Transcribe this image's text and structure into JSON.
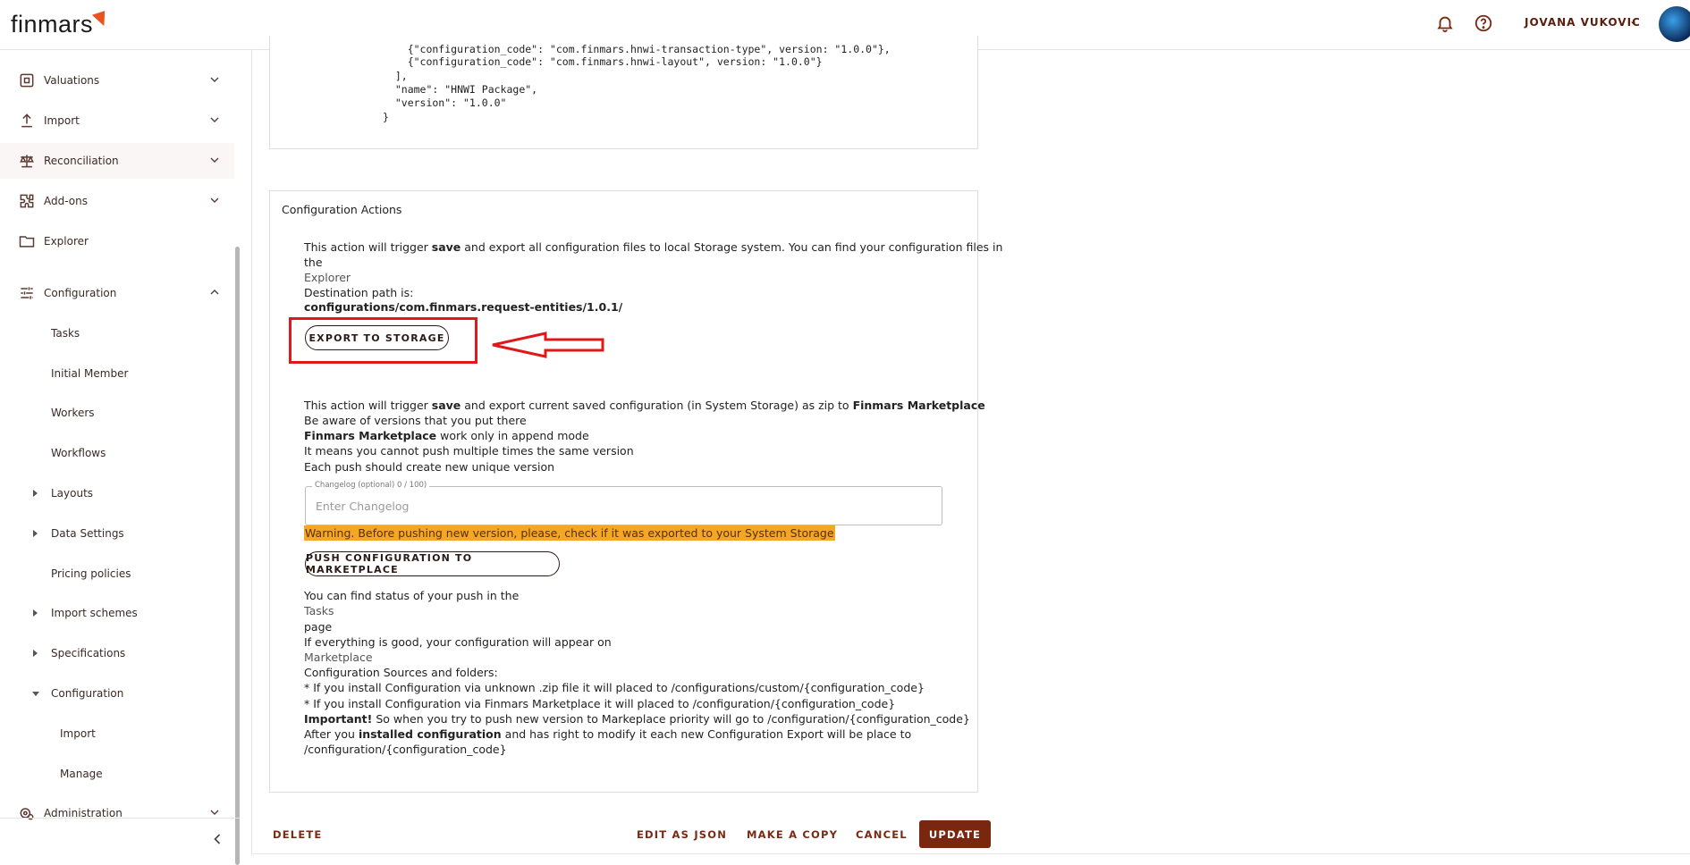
{
  "header": {
    "logo_text": "finmars",
    "user_name": "JOVANA VUKOVIC"
  },
  "sidebar": {
    "top_items": [
      {
        "label": "Valuations",
        "icon": "valuations-icon"
      },
      {
        "label": "Import",
        "icon": "import-icon"
      },
      {
        "label": "Reconciliation",
        "icon": "scale-icon"
      },
      {
        "label": "Add-ons",
        "icon": "puzzle-icon"
      },
      {
        "label": "Explorer",
        "icon": "folder-icon"
      },
      {
        "label": "Configuration",
        "icon": "sliders-icon"
      }
    ],
    "config_children": [
      {
        "label": "Tasks"
      },
      {
        "label": "Initial Member"
      },
      {
        "label": "Workers"
      },
      {
        "label": "Workflows"
      },
      {
        "label": "Layouts"
      },
      {
        "label": "Data Settings"
      },
      {
        "label": "Pricing policies"
      },
      {
        "label": "Import schemes"
      },
      {
        "label": "Specifications"
      },
      {
        "label": "Configuration"
      }
    ],
    "config_sub_children": [
      {
        "label": "Import"
      },
      {
        "label": "Manage"
      }
    ],
    "administration_label": "Administration"
  },
  "code_block": {
    "lines": [
      "    {\"configuration_code\": \"com.finmars.hnwi-transaction-type\", version: \"1.0.0\"},",
      "    {\"configuration_code\": \"com.finmars.hnwi-layout\", version: \"1.0.0\"}",
      "  ],",
      "  \"name\": \"HNWI Package\",",
      "  \"version\": \"1.0.0\"",
      "}"
    ]
  },
  "actions": {
    "title": "Configuration Actions",
    "export": {
      "line1_pre": "This action will trigger ",
      "line1_bold": "save",
      "line1_post": " and export all configuration files to local Storage system. You can find your configuration files in",
      "line1_cont": "the",
      "explorer_link": "Explorer",
      "dest_label": "Destination path is:",
      "dest_path": "configurations/com.finmars.request-entities/1.0.1/",
      "button_label": "EXPORT TO STORAGE"
    },
    "push": {
      "line1_pre": "This action will trigger ",
      "line1_bold": "save",
      "line1_mid": " and export current saved configuration (in System Storage) as zip to ",
      "line1_bold2": "Finmars Marketplace",
      "line2": "Be aware of versions that you put there",
      "line3_bold": "Finmars Marketplace",
      "line3_post": " work only in append mode",
      "line4": "It means you cannot push multiple times the same version",
      "line5": "Each push should create new unique version",
      "changelog_label": "Changelog (optional) 0 / 100)",
      "changelog_placeholder": "Enter Changelog",
      "warning": "Warning. Before pushing new version, please, check if it was exported to your System Storage",
      "button_label": "PUSH CONFIGURATION TO MARKETPLACE"
    },
    "info": {
      "status_line": "You can find status of your push in the",
      "tasks_link": "Tasks",
      "page_word": "page",
      "good_line": "If everything is good, your configuration will appear on",
      "marketplace_link": "Marketplace",
      "sources_line": "Configuration Sources and folders:",
      "zip_line": "* If you install Configuration via unknown .zip file it will placed to /configurations/custom/{configuration_code}",
      "market_line": "* If you install Configuration via Finmars Marketplace it will placed to /configuration/{configuration_code}",
      "important_bold": "Important!",
      "important_post": " So when you try to push new version to Markeplace priority will go to /configuration/{configuration_code}",
      "after_pre": "After you ",
      "after_bold": "installed configuration",
      "after_post": " and has right to modify it each new Configuration Export will be place to",
      "after_path": "/configuration/{configuration_code}"
    }
  },
  "footer": {
    "delete": "DELETE",
    "edit_json": "EDIT AS JSON",
    "make_copy": "MAKE A COPY",
    "cancel": "CANCEL",
    "update": "UPDATE"
  },
  "colors": {
    "brand": "#7a2710",
    "highlight_box": "#e01818",
    "warning_bg": "#f5a623"
  }
}
